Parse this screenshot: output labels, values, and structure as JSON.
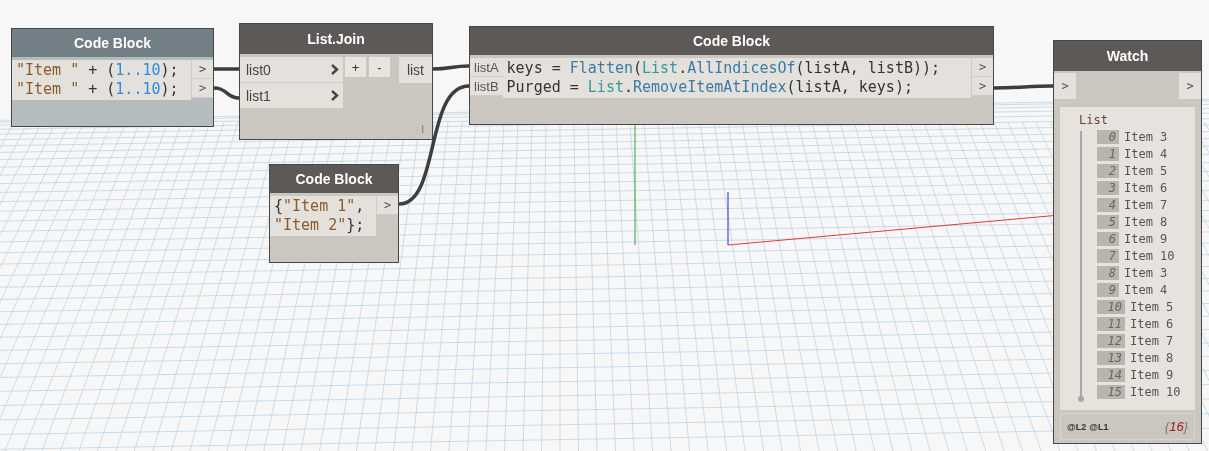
{
  "code_blocks": [
    {
      "title": "Code Block",
      "dimmed": true,
      "lines": [
        [
          {
            "kind": "string",
            "text": "\"Item \""
          },
          {
            "kind": "plain",
            "text": " + ("
          },
          {
            "kind": "number",
            "text": "1..10"
          },
          {
            "kind": "plain",
            "text": ");"
          }
        ],
        [
          {
            "kind": "string",
            "text": "\"Item \""
          },
          {
            "kind": "plain",
            "text": " + ("
          },
          {
            "kind": "number",
            "text": "1..10"
          },
          {
            "kind": "plain",
            "text": ");"
          }
        ]
      ],
      "outputs": [
        ">",
        ">"
      ]
    },
    {
      "title": "Code Block",
      "dimmed": false,
      "lines": [
        [
          {
            "kind": "plain",
            "text": "{"
          },
          {
            "kind": "string",
            "text": "\"Item 1\""
          },
          {
            "kind": "plain",
            "text": ","
          }
        ],
        [
          {
            "kind": "string",
            "text": "\"Item 2\""
          },
          {
            "kind": "plain",
            "text": "};"
          }
        ]
      ],
      "outputs": [
        ">"
      ]
    },
    {
      "title": "Code Block",
      "dimmed": false,
      "inputs": [
        "listA",
        "listB"
      ],
      "lines": [
        [
          {
            "kind": "plain",
            "text": "keys = "
          },
          {
            "kind": "function",
            "text": "Flatten"
          },
          {
            "kind": "plain",
            "text": "("
          },
          {
            "kind": "class",
            "text": "List"
          },
          {
            "kind": "plain",
            "text": "."
          },
          {
            "kind": "function",
            "text": "AllIndicesOf"
          },
          {
            "kind": "plain",
            "text": "(listA, listB));"
          }
        ],
        [
          {
            "kind": "plain",
            "text": "Purged = "
          },
          {
            "kind": "class",
            "text": "List"
          },
          {
            "kind": "plain",
            "text": "."
          },
          {
            "kind": "function",
            "text": "RemoveItemAtIndex"
          },
          {
            "kind": "plain",
            "text": "(listA, keys);"
          }
        ]
      ],
      "outputs": [
        ">",
        ">"
      ]
    }
  ],
  "list_join": {
    "title": "List.Join",
    "inputs": [
      "list0",
      "list1"
    ],
    "add": "+",
    "remove": "-",
    "output": "list",
    "lacing": "l"
  },
  "watch": {
    "title": "Watch",
    "input": ">",
    "output": ">",
    "list_label": "List",
    "items": [
      {
        "index": "0",
        "value": "Item 3"
      },
      {
        "index": "1",
        "value": "Item 4"
      },
      {
        "index": "2",
        "value": "Item 5"
      },
      {
        "index": "3",
        "value": "Item 6"
      },
      {
        "index": "4",
        "value": "Item 7"
      },
      {
        "index": "5",
        "value": "Item 8"
      },
      {
        "index": "6",
        "value": "Item 9"
      },
      {
        "index": "7",
        "value": "Item 10"
      },
      {
        "index": "8",
        "value": "Item 3"
      },
      {
        "index": "9",
        "value": "Item 4"
      },
      {
        "index": "10",
        "value": "Item 5"
      },
      {
        "index": "11",
        "value": "Item 6"
      },
      {
        "index": "12",
        "value": "Item 7"
      },
      {
        "index": "13",
        "value": "Item 8"
      },
      {
        "index": "14",
        "value": "Item 9"
      },
      {
        "index": "15",
        "value": "Item 10"
      }
    ],
    "levels": [
      "@L2",
      "@L1"
    ],
    "count": {
      "open": "{",
      "value": "16",
      "close": "}"
    }
  }
}
